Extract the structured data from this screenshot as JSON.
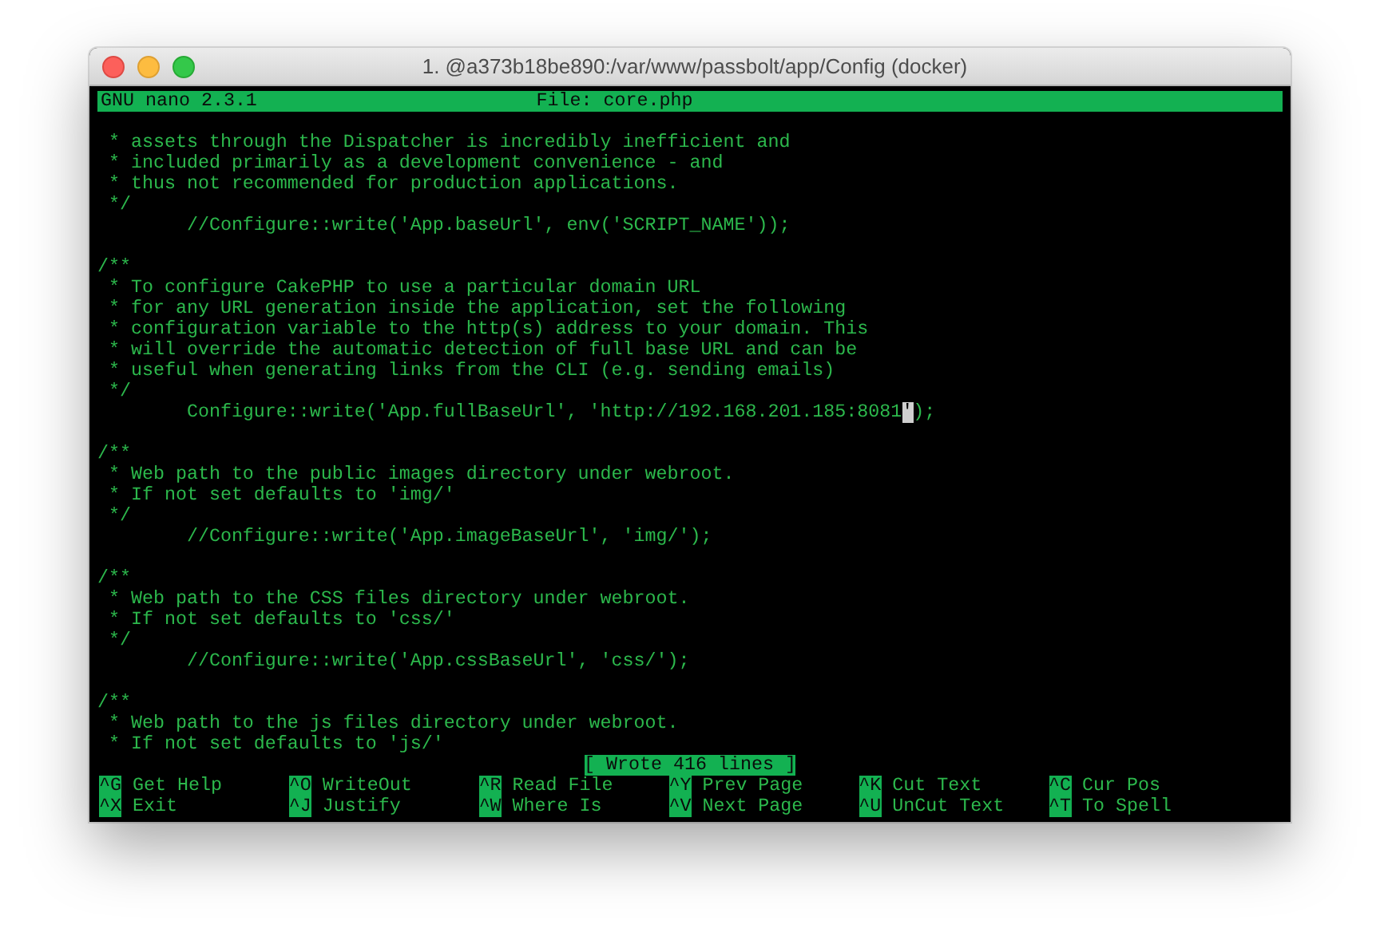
{
  "window": {
    "title": "1. @a373b18be890:/var/www/passbolt/app/Config (docker)"
  },
  "header": {
    "program": "GNU nano 2.3.1",
    "file": "File: core.php"
  },
  "lines": [
    {
      "kind": "blank"
    },
    {
      "kind": "text",
      "text": " * assets through the Dispatcher is incredibly inefficient and"
    },
    {
      "kind": "text",
      "text": " * included primarily as a development convenience - and"
    },
    {
      "kind": "text",
      "text": " * thus not recommended for production applications."
    },
    {
      "kind": "text",
      "text": " */"
    },
    {
      "kind": "text",
      "text": "        //Configure::write('App.baseUrl', env('SCRIPT_NAME'));"
    },
    {
      "kind": "blank"
    },
    {
      "kind": "text",
      "text": "/**"
    },
    {
      "kind": "text",
      "text": " * To configure CakePHP to use a particular domain URL"
    },
    {
      "kind": "text",
      "text": " * for any URL generation inside the application, set the following"
    },
    {
      "kind": "text",
      "text": " * configuration variable to the http(s) address to your domain. This"
    },
    {
      "kind": "text",
      "text": " * will override the automatic detection of full base URL and can be"
    },
    {
      "kind": "text",
      "text": " * useful when generating links from the CLI (e.g. sending emails)"
    },
    {
      "kind": "text",
      "text": " */"
    },
    {
      "kind": "cursor",
      "before": "        Configure::write('App.fullBaseUrl', 'http://192.168.201.185:8081",
      "cursor": "'",
      "after": ");"
    },
    {
      "kind": "blank"
    },
    {
      "kind": "text",
      "text": "/**"
    },
    {
      "kind": "text",
      "text": " * Web path to the public images directory under webroot."
    },
    {
      "kind": "text",
      "text": " * If not set defaults to 'img/'"
    },
    {
      "kind": "text",
      "text": " */"
    },
    {
      "kind": "text",
      "text": "        //Configure::write('App.imageBaseUrl', 'img/');"
    },
    {
      "kind": "blank"
    },
    {
      "kind": "text",
      "text": "/**"
    },
    {
      "kind": "text",
      "text": " * Web path to the CSS files directory under webroot."
    },
    {
      "kind": "text",
      "text": " * If not set defaults to 'css/'"
    },
    {
      "kind": "text",
      "text": " */"
    },
    {
      "kind": "text",
      "text": "        //Configure::write('App.cssBaseUrl', 'css/');"
    },
    {
      "kind": "blank"
    },
    {
      "kind": "text",
      "text": "/**"
    },
    {
      "kind": "text",
      "text": " * Web path to the js files directory under webroot."
    },
    {
      "kind": "text",
      "text": " * If not set defaults to 'js/'"
    }
  ],
  "status": "[ Wrote 416 lines ]",
  "shortcuts": [
    {
      "key": "^G",
      "label": "Get Help"
    },
    {
      "key": "^O",
      "label": "WriteOut"
    },
    {
      "key": "^R",
      "label": "Read File"
    },
    {
      "key": "^Y",
      "label": "Prev Page"
    },
    {
      "key": "^K",
      "label": "Cut Text"
    },
    {
      "key": "^C",
      "label": "Cur Pos"
    },
    {
      "key": "^X",
      "label": "Exit"
    },
    {
      "key": "^J",
      "label": "Justify"
    },
    {
      "key": "^W",
      "label": "Where Is"
    },
    {
      "key": "^V",
      "label": "Next Page"
    },
    {
      "key": "^U",
      "label": "UnCut Text"
    },
    {
      "key": "^T",
      "label": "To Spell"
    }
  ]
}
